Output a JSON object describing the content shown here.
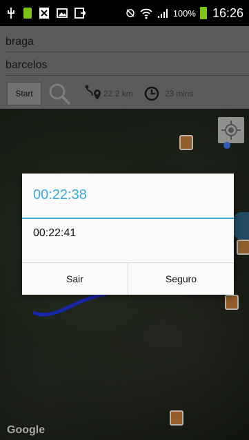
{
  "status_bar": {
    "battery_pct": "100%",
    "time": "16:26"
  },
  "route": {
    "origin": "braga",
    "destination": "barcelos",
    "start_label": "Start",
    "distance": "22.2 km",
    "duration": "23 mins"
  },
  "map": {
    "attribution": "Google"
  },
  "dialog": {
    "title": "00:22:38",
    "message": "00:22:41",
    "buttons": [
      "Sair",
      "Seguro"
    ]
  },
  "colors": {
    "accent": "#3aaad6",
    "battery": "#7ec11a",
    "route": "#1e2fd0"
  },
  "icons": [
    "usb-icon",
    "notification-icon",
    "excel-icon",
    "image-icon",
    "export-icon",
    "no-data-icon",
    "wifi-icon",
    "signal-icon",
    "battery-icon",
    "search-icon",
    "route-icon",
    "clock-icon",
    "my-location-icon"
  ]
}
